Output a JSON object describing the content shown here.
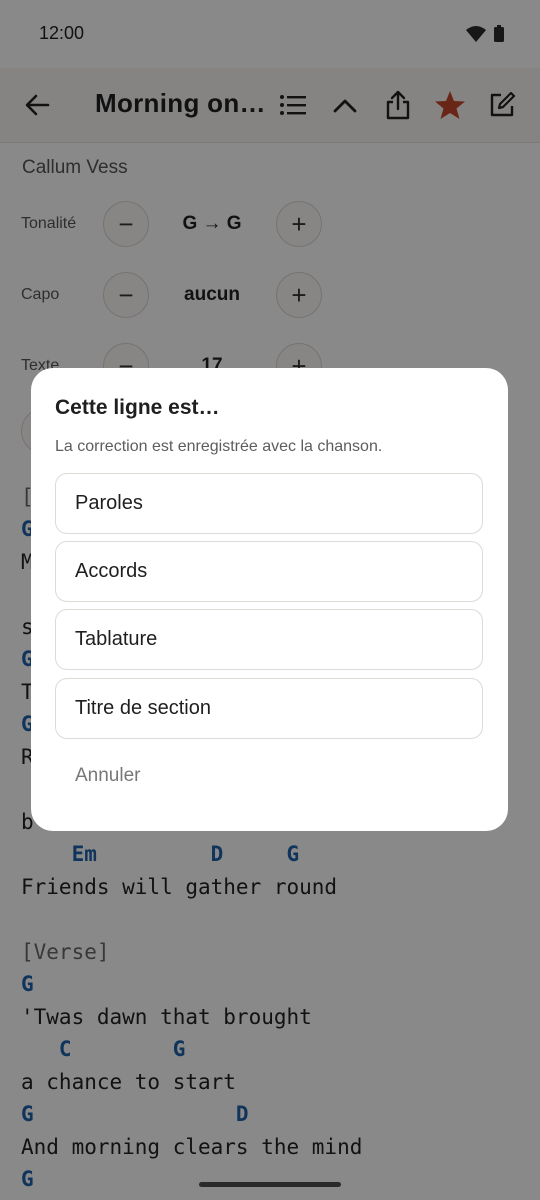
{
  "status": {
    "time": "12:00"
  },
  "appbar": {
    "title": "Morning on the Hill"
  },
  "song": {
    "artist": "Callum Vess",
    "controls": [
      {
        "label": "Tonalité",
        "value": "G → G"
      },
      {
        "label": "Capo",
        "value": "aucun"
      },
      {
        "label": "Texte",
        "value": "17"
      }
    ],
    "lines": [
      {
        "kind": "section",
        "text": "["
      },
      {
        "kind": "chord",
        "text": "G"
      },
      {
        "kind": "lyric",
        "text": "M"
      },
      {
        "kind": "lyric",
        "text": "s"
      },
      {
        "kind": "chord",
        "text": "G"
      },
      {
        "kind": "lyric",
        "text": "T"
      },
      {
        "kind": "chord",
        "text": "G"
      },
      {
        "kind": "lyric",
        "text": "R"
      },
      {
        "kind": "lyric",
        "text": "b"
      },
      {
        "kind": "chord",
        "text": "    Em         D     G"
      },
      {
        "kind": "lyric",
        "text": "Friends will gather round"
      },
      {
        "kind": "section",
        "text": "[Verse]"
      },
      {
        "kind": "chord",
        "text": "G"
      },
      {
        "kind": "lyric",
        "text": "'Twas dawn that brought"
      },
      {
        "kind": "chord",
        "text": "   C        G"
      },
      {
        "kind": "lyric",
        "text": "a chance to start"
      },
      {
        "kind": "chord",
        "text": "G                D"
      },
      {
        "kind": "lyric",
        "text": "And morning clears the mind"
      },
      {
        "kind": "chord",
        "text": "G"
      }
    ]
  },
  "dialog": {
    "title": "Cette ligne est…",
    "subtitle": "La correction est enregistrée avec la chanson.",
    "options": [
      "Paroles",
      "Accords",
      "Tablature",
      "Titre de section"
    ],
    "cancel": "Annuler"
  },
  "colors": {
    "accent_star": "#c0452a",
    "chord_blue": "#1e5fa8"
  }
}
